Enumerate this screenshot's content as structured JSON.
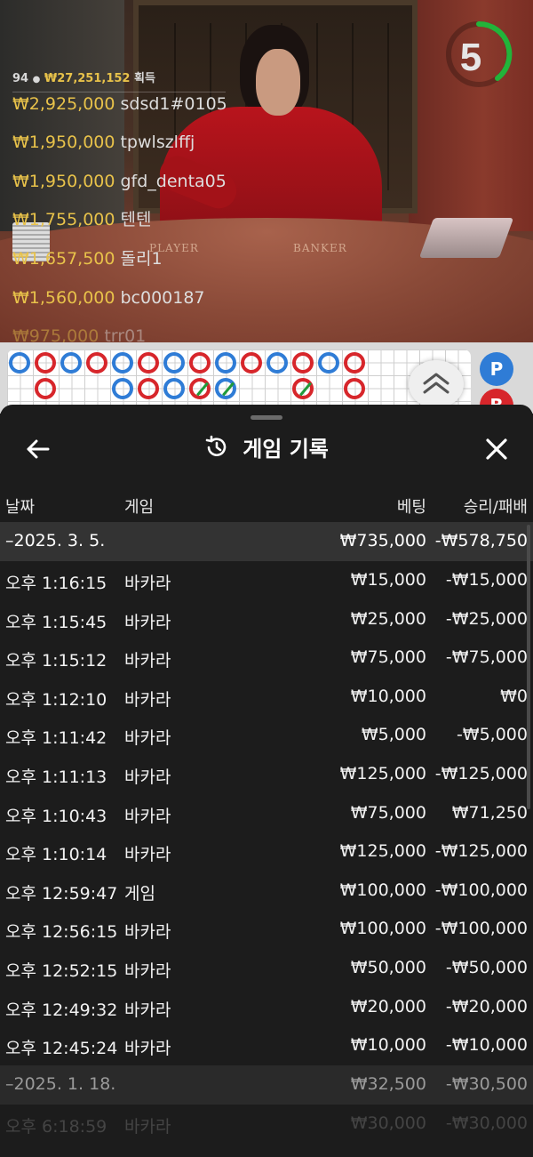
{
  "video": {
    "table_labels": {
      "player": "PLAYER",
      "banker": "BANKER"
    },
    "countdown": "5",
    "winners": {
      "count": "94",
      "total": "₩27,251,152",
      "total_suffix": "획득",
      "rows": [
        {
          "amount": "₩2,925,000",
          "name": "sdsd1#0105"
        },
        {
          "amount": "₩1,950,000",
          "name": "tpwlszlffj"
        },
        {
          "amount": "₩1,950,000",
          "name": "gfd_denta05"
        },
        {
          "amount": "₩1,755,000",
          "name": "텐텐"
        },
        {
          "amount": "₩1,657,500",
          "name": "돌리1"
        },
        {
          "amount": "₩1,560,000",
          "name": "bc000187"
        },
        {
          "amount": "₩975,000",
          "name": "trr01"
        }
      ]
    }
  },
  "roadmap": {
    "side": {
      "player": "P",
      "banker": "B"
    }
  },
  "history": {
    "title": "게임 기록",
    "columns": {
      "date": "날짜",
      "game": "게임",
      "bet": "베팅",
      "win_loss": "승리/패배"
    },
    "groups": [
      {
        "date": "–2025. 3. 5.",
        "bet": "₩735,000",
        "win_loss": "-₩578,750",
        "rows": [
          {
            "time": "오후 1:16:15",
            "game": "바카라",
            "bet": "₩15,000",
            "win_loss": "-₩15,000"
          },
          {
            "time": "오후 1:15:45",
            "game": "바카라",
            "bet": "₩25,000",
            "win_loss": "-₩25,000"
          },
          {
            "time": "오후 1:15:12",
            "game": "바카라",
            "bet": "₩75,000",
            "win_loss": "-₩75,000"
          },
          {
            "time": "오후 1:12:10",
            "game": "바카라",
            "bet": "₩10,000",
            "win_loss": "₩0"
          },
          {
            "time": "오후 1:11:42",
            "game": "바카라",
            "bet": "₩5,000",
            "win_loss": "-₩5,000"
          },
          {
            "time": "오후 1:11:13",
            "game": "바카라",
            "bet": "₩125,000",
            "win_loss": "-₩125,000"
          },
          {
            "time": "오후 1:10:43",
            "game": "바카라",
            "bet": "₩75,000",
            "win_loss": "₩71,250"
          },
          {
            "time": "오후 1:10:14",
            "game": "바카라",
            "bet": "₩125,000",
            "win_loss": "-₩125,000"
          },
          {
            "time": "오후 12:59:47",
            "game": "게임",
            "bet": "₩100,000",
            "win_loss": "-₩100,000"
          },
          {
            "time": "오후 12:56:15",
            "game": "바카라",
            "bet": "₩100,000",
            "win_loss": "-₩100,000"
          },
          {
            "time": "오후 12:52:15",
            "game": "바카라",
            "bet": "₩50,000",
            "win_loss": "-₩50,000"
          },
          {
            "time": "오후 12:49:32",
            "game": "바카라",
            "bet": "₩20,000",
            "win_loss": "-₩20,000"
          },
          {
            "time": "오후 12:45:24",
            "game": "바카라",
            "bet": "₩10,000",
            "win_loss": "-₩10,000"
          }
        ]
      },
      {
        "date": "–2025. 1. 18.",
        "bet": "₩32,500",
        "win_loss": "-₩30,500",
        "rows": [
          {
            "time": "오후 6:18:59",
            "game": "바카라",
            "bet": "₩30,000",
            "win_loss": "-₩30,000"
          }
        ]
      }
    ]
  }
}
